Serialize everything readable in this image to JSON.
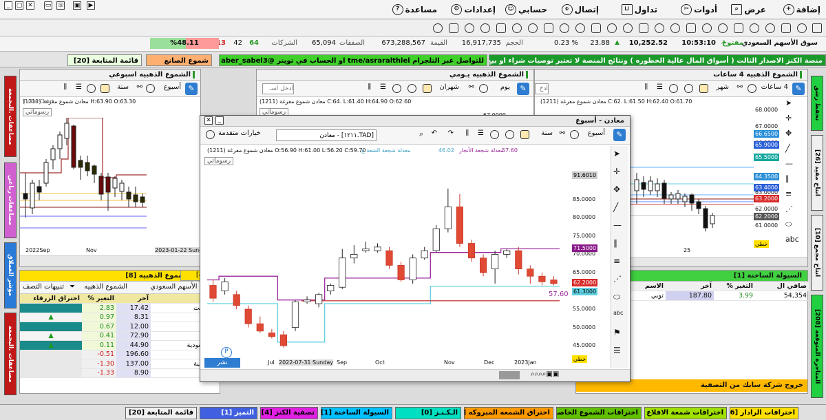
{
  "menu": {
    "add": "إضافة",
    "view": "عرض",
    "tools": "أدوات",
    "trading": "تداول",
    "connect": "إتصال",
    "account": "حسابي",
    "settings": "إعدادات",
    "help": "مساعدة"
  },
  "stats": {
    "market": "سوق الأسهم السعودي",
    "state": "مفتوح",
    "time": "10:53:10",
    "index": "10,252.52",
    "change": "23.88",
    "change_pct": "% 0.23",
    "volume_label": "الحجم",
    "volume": "16,917,735",
    "value_label": "القيمة",
    "value": "673,288,567",
    "deals_label": "الصفقات",
    "deals": "65,094",
    "companies_label": "الشركات",
    "up": "64",
    "flat": "42",
    "down": "113",
    "pct": "%48.11"
  },
  "ticker": {
    "seg1": "منصة الكنز الاصدار الثالث ( أسواق المال عالية الخطوره ) ونتائج المنصة لا تعتبر توصيات شراء او بيع",
    "seg2": "للتواصل عبر التلجرام  tme/asraralthlel   او الحساب في تويتر @aber_sabel3",
    "seg3": "شموع الصانع",
    "seg4": "قائمة المتابعة [20]"
  },
  "left_tabs": [
    "مضاعفات .البجمعة",
    "مضاعفات رباعي",
    "مؤشر العملاق",
    "مضاعفات .البجمعة"
  ],
  "right_tabs": [
    "تحفظ رشق",
    "[26] انتاج مفيد",
    "[10] انتاج مجمع",
    "[208] المتاجرة المتوقعة"
  ],
  "panel_weekly": {
    "title": "الشموع الذهبيه اسبوعي",
    "period": "سنة",
    "interval": "أسبوع",
    "ohlc": "(1211) معادن  شموع مفرغة  H:63.90  O:63.30",
    "watermark": "TickerChart",
    "manual": "رسوماتي",
    "x_labels": [
      "2022Sep",
      "Nov",
      "2023-01-22 Sunday"
    ]
  },
  "panel_daily": {
    "title": "الشموع الذهبيه يـومي",
    "period": "شهران",
    "interval": "يوم",
    "input_placeholder": "ادخل اسـ",
    "ohlc": "(1211) معادن  شموع مفرغة  C:64.  L:61.40  H:64.90  O:62.60",
    "watermark": "TickerChart",
    "manual": "رسوماتي",
    "price_top": "67.0000"
  },
  "panel_4h": {
    "title": "الشموع الذهبيه 4 ساعات",
    "period": "شهر",
    "interval": "4 ساعات",
    "input_placeholder": "ادخ",
    "ohlc": "(1211) معادن  شموع مفرغة  C:62.  L:61.50  H:62.40  O:61.70",
    "watermark": "TickerChart",
    "manual": "رسوماتي",
    "y_labels": [
      "68.0000",
      "67.0000",
      "66.0000",
      "65.0000",
      "64.0000",
      "63.0000",
      "62.0000",
      "61.0000"
    ],
    "price_boxes": [
      {
        "v": "66.6500",
        "c": "#2a8fd8"
      },
      {
        "v": "65.9000",
        "c": "#2a5fd8"
      },
      {
        "v": "65.5000",
        "c": "#17a8a0"
      },
      {
        "v": "64.3500",
        "c": "#2a8fd8"
      },
      {
        "v": "63.4000",
        "c": "#2a5fd8"
      },
      {
        "v": "63.2000",
        "c": "#d82a2a"
      },
      {
        "v": "62.2000",
        "c": "#555555"
      }
    ],
    "line_label": "خطي",
    "x_label": "25"
  },
  "main_chart": {
    "title": "معادن - أسبوع",
    "adv_options": "خيارات متقدمة",
    "symbol_input": "[TAD.١٢١١] - معادن",
    "period": "سنة",
    "interval": "أسبوع",
    "ohlc": "(1211) معادن  شموع مفرغة  O:56.90  H:61.00  L:56.20  C:59.70",
    "indicator1": "معدلة شجعة الشعة ع",
    "indicator1_val": "46.02",
    "indicator2": "معدلة شجعة الأنجار",
    "indicator2_val": "57.60",
    "watermark": "TickerChart",
    "manual": "رسوماتي",
    "publish": "نشر",
    "line_label": "خطي",
    "badge_57": "57.60"
  },
  "chart_data": {
    "type": "candlestick",
    "x_tick_labels": [
      "Jul",
      "2022-07-31 Sunday",
      "Sep",
      "Oct",
      "Nov",
      "Dec",
      "2023Jan"
    ],
    "y_tick_labels": [
      "85.0000",
      "80.0000",
      "75.0000",
      "70.0000",
      "65.0000",
      "60.0000",
      "55.0000",
      "50.0000",
      "45.0000"
    ],
    "ylim": [
      42,
      94
    ],
    "candles": [
      {
        "o": 61.5,
        "c": 58.0,
        "h": 63.0,
        "l": 57.0
      },
      {
        "o": 60.0,
        "c": 62.5,
        "h": 63.5,
        "l": 59.0
      },
      {
        "o": 59.0,
        "c": 56.0,
        "h": 60.0,
        "l": 55.0
      },
      {
        "o": 55.0,
        "c": 51.0,
        "h": 56.0,
        "l": 50.0
      },
      {
        "o": 51.0,
        "c": 49.0,
        "h": 53.0,
        "l": 48.5
      },
      {
        "o": 48.5,
        "c": 47.5,
        "h": 49.5,
        "l": 47.0
      },
      {
        "o": 48.0,
        "c": 45.0,
        "h": 49.0,
        "l": 44.5
      },
      {
        "o": 50.0,
        "c": 57.0,
        "h": 57.5,
        "l": 49.0
      },
      {
        "o": 57.0,
        "c": 57.5,
        "h": 58.5,
        "l": 56.5
      },
      {
        "o": 56.5,
        "c": 59.0,
        "h": 59.5,
        "l": 55.5
      },
      {
        "o": 60.0,
        "c": 61.5,
        "h": 62.0,
        "l": 59.0
      },
      {
        "o": 61.0,
        "c": 69.0,
        "h": 71.5,
        "l": 60.5
      },
      {
        "o": 69.0,
        "c": 70.0,
        "h": 72.5,
        "l": 67.5
      },
      {
        "o": 71.0,
        "c": 71.5,
        "h": 73.5,
        "l": 70.5
      },
      {
        "o": 71.0,
        "c": 72.0,
        "h": 73.0,
        "l": 70.5
      },
      {
        "o": 71.0,
        "c": 67.0,
        "h": 72.0,
        "l": 66.0
      },
      {
        "o": 67.0,
        "c": 63.0,
        "h": 68.0,
        "l": 62.5
      },
      {
        "o": 63.0,
        "c": 69.0,
        "h": 70.0,
        "l": 62.0
      },
      {
        "o": 69.0,
        "c": 71.0,
        "h": 72.0,
        "l": 68.5
      },
      {
        "o": 71.0,
        "c": 77.0,
        "h": 78.0,
        "l": 70.5
      },
      {
        "o": 77.0,
        "c": 83.0,
        "h": 88.0,
        "l": 76.0
      },
      {
        "o": 83.0,
        "c": 73.0,
        "h": 86.5,
        "l": 72.0
      },
      {
        "o": 73.0,
        "c": 69.0,
        "h": 74.0,
        "l": 68.0
      },
      {
        "o": 69.0,
        "c": 65.0,
        "h": 70.0,
        "l": 64.0
      },
      {
        "o": 66.0,
        "c": 70.0,
        "h": 71.0,
        "l": 62.0
      },
      {
        "o": 70.0,
        "c": 71.0,
        "h": 71.5,
        "l": 69.0
      },
      {
        "o": 71.0,
        "c": 66.0,
        "h": 72.0,
        "l": 64.5
      },
      {
        "o": 66.0,
        "c": 64.0,
        "h": 67.0,
        "l": 62.0
      },
      {
        "o": 64.0,
        "c": 62.5,
        "h": 65.0,
        "l": 61.5
      },
      {
        "o": 63.0,
        "c": 62.0,
        "h": 64.0,
        "l": 61.5
      }
    ],
    "lines": [
      {
        "name": "cyan",
        "color": "#5fd0e0",
        "values": [
          56.5,
          56.5,
          56.5,
          56.5,
          56.5,
          56.5,
          46.0,
          46.0,
          46.0,
          46.0,
          56.5,
          56.5,
          56.5,
          56.5,
          56.5,
          56.5,
          56.5,
          56.5,
          56.5,
          61.3,
          61.3,
          61.3,
          61.3,
          61.3,
          61.3,
          61.3,
          61.3,
          61.3,
          61.3,
          61.3
        ]
      },
      {
        "name": "purple",
        "color": "#9b2a9b",
        "values": [
          63.0,
          64.0,
          64.0,
          64.0,
          64.0,
          64.0,
          57.5,
          57.5,
          57.5,
          57.5,
          63.5,
          63.5,
          63.5,
          63.5,
          63.5,
          63.5,
          63.5,
          63.5,
          63.5,
          70.5,
          70.5,
          70.5,
          70.5,
          70.5,
          70.5,
          71.5,
          71.5,
          71.5,
          71.5,
          71.5
        ]
      },
      {
        "name": "red",
        "color": "#c84040",
        "values": [
          null,
          null,
          null,
          null,
          null,
          null,
          null,
          null,
          57.3,
          57.3,
          57.3,
          57.3,
          57.3,
          57.3,
          57.3,
          57.3,
          57.3,
          57.3,
          57.3,
          57.3,
          57.3,
          57.3,
          57.3,
          57.3,
          57.3,
          57.3,
          57.3,
          57.3,
          57.3,
          57.3
        ]
      }
    ],
    "price_boxes": [
      {
        "v": "91.6010",
        "c": "#cccccc",
        "t": "#000000"
      },
      {
        "v": "71.5000",
        "c": "#8a1a8a",
        "t": "#ffffff"
      },
      {
        "v": "62.2000",
        "c": "#d82a2a",
        "t": "#ffffff"
      },
      {
        "v": "61.3000",
        "c": "#5fd0e0",
        "t": "#000000"
      }
    ]
  },
  "candle_list": {
    "title": "تصفية الشموع الذهبيه [8]",
    "alerts": "تنبيهات التصف",
    "filter": "الشموع الذهبيه",
    "market": "سوق الأسهم السعودي",
    "headers": [
      "اختراق الزرقاء",
      "التغير %",
      "آخر",
      "الاسم"
    ],
    "rows": [
      {
        "pct": "2.83",
        "last": "17.42",
        "name": "زيرة ريت",
        "arrow": false,
        "neg": false
      },
      {
        "pct": "0.97",
        "last": "8.31",
        "name": "ار",
        "arrow": true,
        "neg": false
      },
      {
        "pct": "0.67",
        "last": "12.00",
        "name": "صنيع",
        "arrow": false,
        "neg": false
      },
      {
        "pct": "0.41",
        "last": "72.90",
        "name": "ريس",
        "arrow": true,
        "neg": false
      },
      {
        "pct": "0.11",
        "last": "44.90",
        "name": "لة السعودية",
        "arrow": true,
        "neg": false
      },
      {
        "pct": "0.51-",
        "last": "196.60",
        "name": "ساة",
        "arrow": false,
        "neg": true
      },
      {
        "pct": "1.30-",
        "last": "137.00",
        "name": "ك العربية",
        "arrow": false,
        "neg": true
      },
      {
        "pct": "1.33-",
        "last": "8.90",
        "name": "عادة",
        "arrow": false,
        "neg": true
      }
    ]
  },
  "liquidity": {
    "title": "السيولة الساخنة [1]",
    "headers": [
      "الاسم",
      "آخر",
      "التغير %",
      "صافي ال"
    ],
    "row": {
      "name": "توبي",
      "last": "187.80",
      "pct": "3.99",
      "net": "54,354"
    }
  },
  "exit_msg": "خروج شركة سابك من التصفية",
  "mini_tab": "[4]",
  "bottom_tabs": [
    {
      "label": "اختراقات الرادار [6]",
      "bg": "#ffe000"
    },
    {
      "label": "اختراقات شمعة الافلاع [8]",
      "bg": "#a0e000"
    },
    {
      "label": "اختراقات الشموع الخاصه [3]",
      "bg": "#60c000"
    },
    {
      "label": "اختراق الشمعه المبروكه [3]",
      "bg": "#ff9900"
    },
    {
      "label": "الـكـنـز [0]",
      "bg": "#00e0c0"
    },
    {
      "label": "السيولة الساخنة [1]",
      "bg": "#00c0ff"
    },
    {
      "label": "تصفية الكنز [4]",
      "bg": "#e020e0"
    },
    {
      "label": "التميز [1]",
      "bg": "#4060e0"
    },
    {
      "label": "قائمة المتابعة [20]",
      "bg": "#f0f0f0"
    }
  ]
}
